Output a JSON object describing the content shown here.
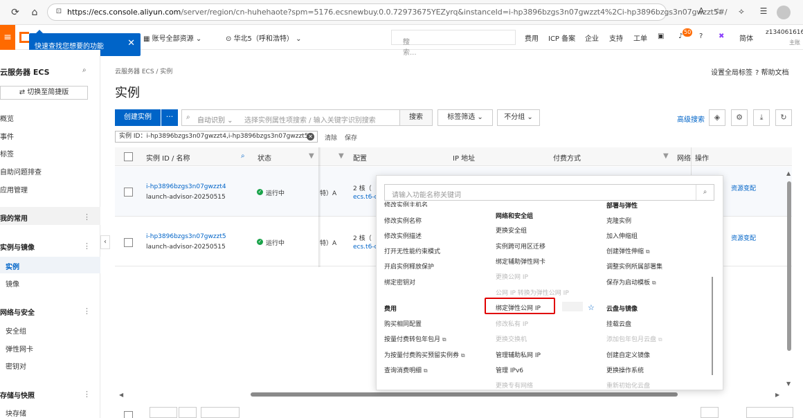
{
  "browser": {
    "url_host": "https://ecs.console.aliyun.com",
    "url_rest": "/server/region/cn-huhehaote?spm=5176.ecsnewbuy.0.0.72973675YEZyrq&instanceId=i-hp3896bzgs3n07gwzzt4%2Ci-hp3896bzgs3n07gwzzt5#/"
  },
  "header": {
    "menu_icon": "hamburger-icon",
    "tooltip_text": "快速查找您想要的功能",
    "resource_group": "账号全部资源",
    "region": "华北5（呼和浩特）",
    "search_placeholder": "搜索...",
    "links": [
      "费用",
      "ICP 备案",
      "企业",
      "支持",
      "工单"
    ],
    "notification_count": "50",
    "lang": "简体",
    "user": "z13406161616",
    "user_sub": "主账"
  },
  "sidebar": {
    "title": "云服务器 ECS",
    "switch_label": "切换至简捷版",
    "items": [
      "概览",
      "事件",
      "标签",
      "自助问题排查",
      "应用管理"
    ],
    "favorites": "我的常用",
    "group_instances": "实例与镜像",
    "instances": "实例",
    "images": "镜像",
    "group_network": "网络与安全",
    "security_group": "安全组",
    "eni": "弹性网卡",
    "keypair": "密钥对",
    "group_storage": "存储与快照",
    "block_storage": "块存储"
  },
  "main": {
    "breadcrumb": "云服务器 ECS  /  实例",
    "title": "实例",
    "global_tags": "设置全局标签",
    "help": "帮助文档",
    "create_btn": "创建实例",
    "more_btn": "···",
    "filter_mode": "自动识别",
    "filter_placeholder": "选择实例属性项搜索 / 输入关键字识别搜索",
    "search_btn": "搜索",
    "tag_filter": "标签筛选",
    "group_filter": "不分组",
    "advanced_search": "高级搜索",
    "chip_text": "实例 ID：i-hp3896bzgs3n07gwzzt4,i-hp3896bzgs3n07gwzzt5",
    "clear": "清除",
    "save": "保存"
  },
  "table": {
    "headers": {
      "id": "实例 ID / 名称",
      "status": "状态",
      "config": "配置",
      "ip": "IP 地址",
      "billing": "付费方式",
      "network": "网络",
      "ops": "操作"
    },
    "rows": [
      {
        "id": "i-hp3896bzgs3n07gwzzt4",
        "name": "launch-advisor-20250515",
        "status": "运行中",
        "zone": "特）A",
        "cpu": "2 核（",
        "spec": "ecs.t6-c",
        "op": "资源变配"
      },
      {
        "id": "i-hp3896bzgs3n07gwzzt5",
        "name": "launch-advisor-20250515",
        "status": "运行中",
        "zone": "特）A",
        "cpu": "2 核（",
        "spec": "ecs.t6-c",
        "op": "资源变配"
      }
    ]
  },
  "panel": {
    "search_placeholder": "请输入功能名称关键词",
    "col1": {
      "top_cut": "修改实例主机名",
      "items": [
        "修改实例名称",
        "修改实例描述",
        "打开无性能约束模式",
        "开启实例释放保护",
        "绑定密钥对"
      ],
      "billing_header": "费用",
      "billing": [
        "购买相同配置",
        "按量付费转包年包月",
        "为按量付费购买预留实例券",
        "查询消费明细"
      ]
    },
    "col2": {
      "header": "网络和安全组",
      "items": [
        "更换安全组",
        "实例跨可用区迁移",
        "绑定辅助弹性网卡"
      ],
      "dis1": "更换公网 IP",
      "dis2": "公网 IP 转换为弹性公网 IP",
      "highlight": "绑定弹性公网 IP",
      "dis3": "修改私有 IP",
      "dis4": "更换交换机",
      "items2": [
        "管理辅助私网 IP",
        "管理 IPv6"
      ],
      "dis5": "更换专有网络"
    },
    "col3": {
      "header": "部署与弹性",
      "items": [
        "克隆实例",
        "加入伸缩组",
        "创建弹性伸缩",
        "调整实例所属部署集",
        "保存为启动模板"
      ],
      "disk_header": "云盘与镜像",
      "disk1": "挂载云盘",
      "disk_dis1": "添加包年包月云盘",
      "disk2": "创建自定义镜像",
      "disk3": "更换操作系统",
      "disk_dis2": "重新初始化云盘"
    }
  }
}
